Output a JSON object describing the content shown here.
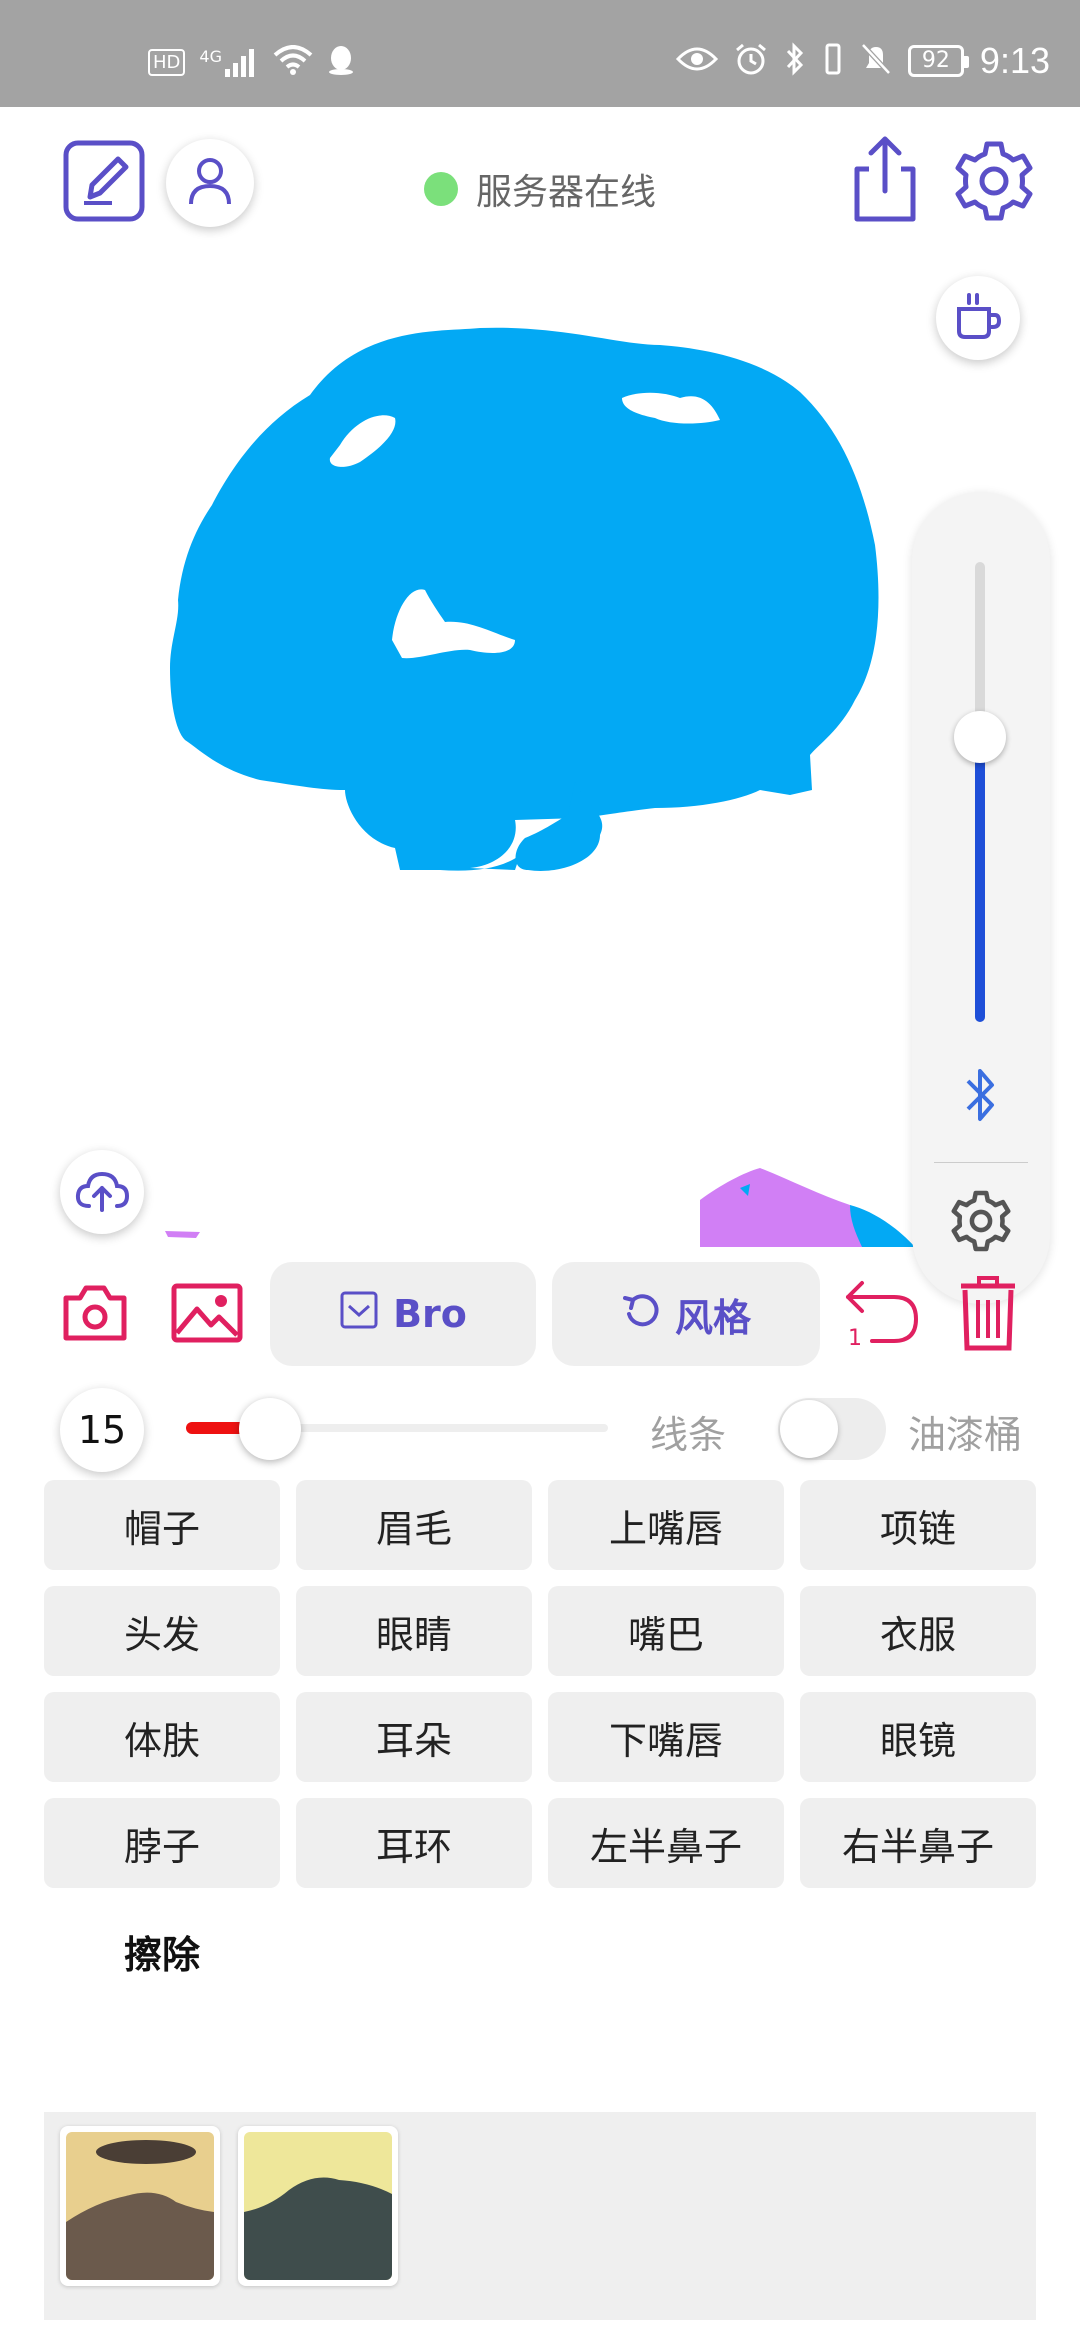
{
  "status_bar": {
    "hd": "HD",
    "network": "4G",
    "battery": "92",
    "time": "9:13"
  },
  "header": {
    "server_status": "服务器在线"
  },
  "toolbar": {
    "mask_button": "Bro",
    "style_button": "风格",
    "undo_count": "1"
  },
  "brush": {
    "size": "15",
    "size_fraction": 0.2,
    "line_label": "线条",
    "bucket_label": "油漆桶",
    "bucket_enabled": false
  },
  "vertical_slider": {
    "level_fraction": 0.62
  },
  "parts": [
    "帽子",
    "眉毛",
    "上嘴唇",
    "项链",
    "头发",
    "眼睛",
    "嘴巴",
    "衣服",
    "体肤",
    "耳朵",
    "下嘴唇",
    "眼镜",
    "脖子",
    "耳环",
    "左半鼻子",
    "右半鼻子"
  ],
  "erase_label": "擦除",
  "colors": {
    "accent": "#5a4fc7",
    "danger": "#e02060",
    "brush": "#ee1111",
    "mask_blue": "#03a9f4",
    "mask_purple": "#d17ff5",
    "server_online": "#7be07b"
  },
  "icons": {
    "edit": "edit-square-icon",
    "profile": "person-icon",
    "share": "share-icon",
    "settings": "gear-icon",
    "coffee": "coffee-cup-icon",
    "bluetooth": "bluetooth-icon",
    "upload": "cloud-upload-icon",
    "camera": "camera-icon",
    "gallery": "image-icon",
    "undo": "undo-icon",
    "trash": "trash-icon"
  }
}
